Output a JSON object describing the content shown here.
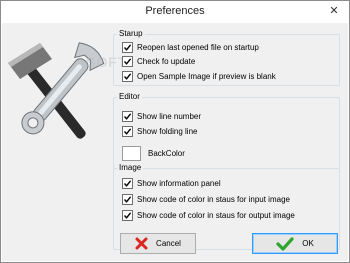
{
  "window": {
    "title": "Preferences",
    "close_glyph": "✕"
  },
  "watermark": "SOFT",
  "groups": {
    "startup": {
      "label": "Starup",
      "items": [
        {
          "label": "Reopen last opened file on startup",
          "checked": true
        },
        {
          "label": "Check fo update",
          "checked": true
        },
        {
          "label": "Open Sample Image if preview is blank",
          "checked": true
        }
      ]
    },
    "editor": {
      "label": "Editor",
      "items": [
        {
          "label": "Show line number",
          "checked": true
        },
        {
          "label": "Show folding line",
          "checked": true
        }
      ],
      "backcolor": {
        "label": "BackColor",
        "color": "#ffffff"
      }
    },
    "image": {
      "label": "Image",
      "items": [
        {
          "label": "Show information panel",
          "checked": true
        },
        {
          "label": "Show code of color in staus for input image",
          "checked": true
        },
        {
          "label": "Show code of color in staus for output image",
          "checked": true
        }
      ]
    }
  },
  "buttons": {
    "cancel": {
      "label": "Cancel",
      "icon": "red-x-icon"
    },
    "ok": {
      "label": "OK",
      "icon": "green-check-icon"
    }
  },
  "colors": {
    "accent": "#3399ff",
    "cancel_icon": "#d9281f",
    "ok_icon": "#2fa52f"
  }
}
